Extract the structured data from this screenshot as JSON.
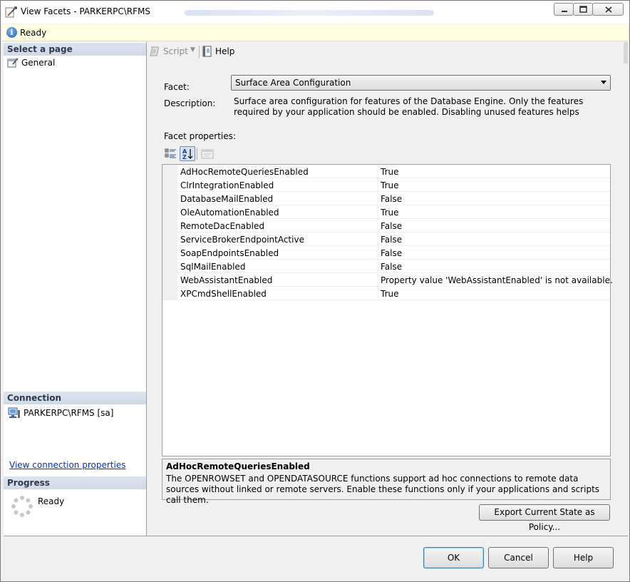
{
  "window": {
    "title": "View Facets - PARKERPC\\RFMS"
  },
  "status": {
    "text": "Ready"
  },
  "left": {
    "select_page_header": "Select a page",
    "pages": [
      {
        "label": "General",
        "icon": "wrench-page-icon"
      }
    ],
    "connection_header": "Connection",
    "connection_value": "PARKERPC\\RFMS [sa]",
    "view_connection_link": "View connection properties",
    "progress_header": "Progress",
    "progress_status": "Ready"
  },
  "toolbar": {
    "script_label": "Script",
    "help_label": "Help"
  },
  "facet": {
    "label": "Facet:",
    "selected": "Surface Area Configuration",
    "description_label": "Description:",
    "description": "Surface area configuration for features of the Database Engine. Only the features required by your application should be enabled. Disabling unused features helps protect your server by reducing the",
    "properties_label": "Facet properties:"
  },
  "properties": [
    {
      "name": "AdHocRemoteQueriesEnabled",
      "value": "True"
    },
    {
      "name": "ClrIntegrationEnabled",
      "value": "True"
    },
    {
      "name": "DatabaseMailEnabled",
      "value": "False"
    },
    {
      "name": "OleAutomationEnabled",
      "value": "True"
    },
    {
      "name": "RemoteDacEnabled",
      "value": "False"
    },
    {
      "name": "ServiceBrokerEndpointActive",
      "value": "False"
    },
    {
      "name": "SoapEndpointsEnabled",
      "value": "False"
    },
    {
      "name": "SqlMailEnabled",
      "value": "False"
    },
    {
      "name": "WebAssistantEnabled",
      "value": "Property value 'WebAssistantEnabled' is not available."
    },
    {
      "name": "XPCmdShellEnabled",
      "value": "True"
    }
  ],
  "help_panel": {
    "title": "AdHocRemoteQueriesEnabled",
    "description": "The OPENROWSET and OPENDATASOURCE functions support ad hoc connections to remote data sources without linked or remote servers. Enable these functions only if your applications and scripts call them."
  },
  "buttons": {
    "export": "Export Current State as Policy...",
    "ok": "OK",
    "cancel": "Cancel",
    "help": "Help"
  },
  "colors": {
    "section_header": "#cfd9e6",
    "status_bar": "#ffffe1",
    "link": "#0033cc",
    "default_button_border": "#3c7fb1"
  }
}
